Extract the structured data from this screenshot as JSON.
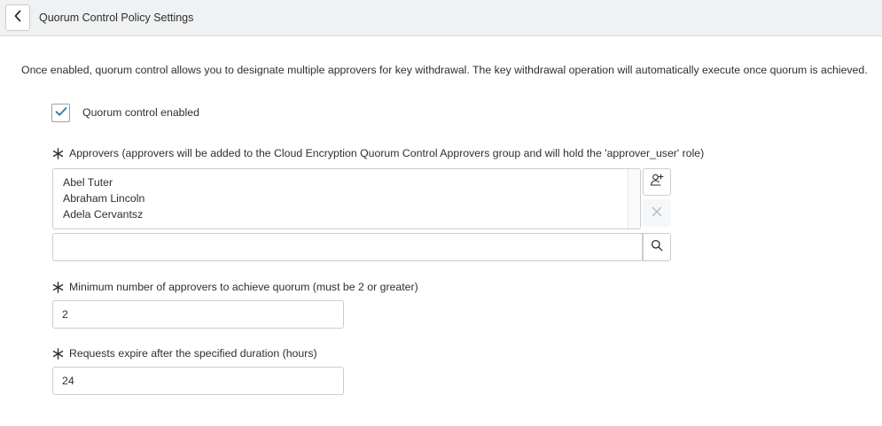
{
  "header": {
    "title": "Quorum Control Policy Settings",
    "back_icon": "chevron-left-icon"
  },
  "intro": {
    "text": "Once enabled, quorum control allows you to designate multiple approvers for key withdrawal. The key withdrawal operation will automatically execute once quorum is achieved."
  },
  "quorum_enabled": {
    "label": "Quorum control enabled",
    "checked": true
  },
  "approvers": {
    "label": "Approvers (approvers will be added to the Cloud Encryption Quorum Control Approvers group and will hold the 'approver_user' role)",
    "items": [
      "Abel Tuter",
      "Abraham Lincoln",
      "Adela Cervantsz"
    ],
    "search_value": ""
  },
  "min_approvers": {
    "label": "Minimum number of approvers to achieve quorum (must be 2 or greater)",
    "value": "2"
  },
  "expiry": {
    "label": "Requests expire after the specified duration (hours)",
    "value": "24"
  },
  "colors": {
    "check": "#2f7a9a",
    "mandatory": "#2e2e2e",
    "header_bg": "#eff1f2",
    "border": "#c9cdd1"
  }
}
